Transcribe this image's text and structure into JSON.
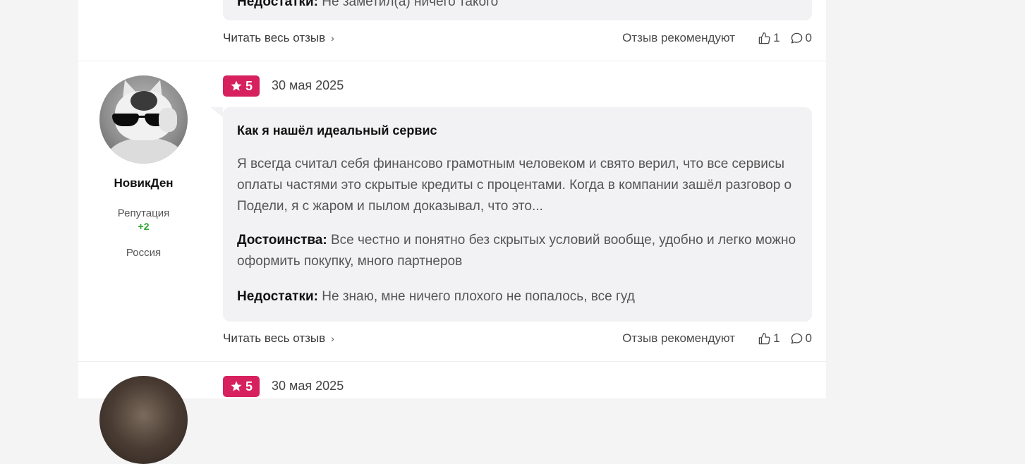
{
  "prev_review": {
    "cons_label": "Недостатки:",
    "cons_text": "Не заметил(а) ничего такого",
    "read_more": "Читать весь отзыв",
    "recommend_text": "Отзыв рекомендуют",
    "likes": "1",
    "comments": "0"
  },
  "review": {
    "author": "НовикДен",
    "reputation_label": "Репутация",
    "reputation_value": "+2",
    "country": "Россия",
    "rating": "5",
    "date": "30 мая 2025",
    "title": "Как я нашёл идеальный сервис",
    "body": "Я всегда считал себя финансово грамотным человеком и свято верил, что все сервисы оплаты частями это скрытые кредиты с процентами. Когда в компании зашёл разговор о Подели, я с жаром и пылом доказывал, что это...",
    "pros_label": "Достоинства:",
    "pros_text": "Все честно и понятно без скрытых условий вообще, удобно и легко можно оформить покупку, много партнеров",
    "cons_label": "Недостатки:",
    "cons_text": "Не знаю, мне ничего плохого не попалось, все гуд",
    "read_more": "Читать весь отзыв",
    "recommend_text": "Отзыв рекомендуют",
    "likes": "1",
    "comments": "0"
  },
  "next_review": {
    "rating": "5",
    "date": "30 мая 2025"
  },
  "colors": {
    "rating_badge": "#d6215e",
    "reputation_positive": "#2aa52e",
    "bubble_bg": "#f2f2f4"
  }
}
